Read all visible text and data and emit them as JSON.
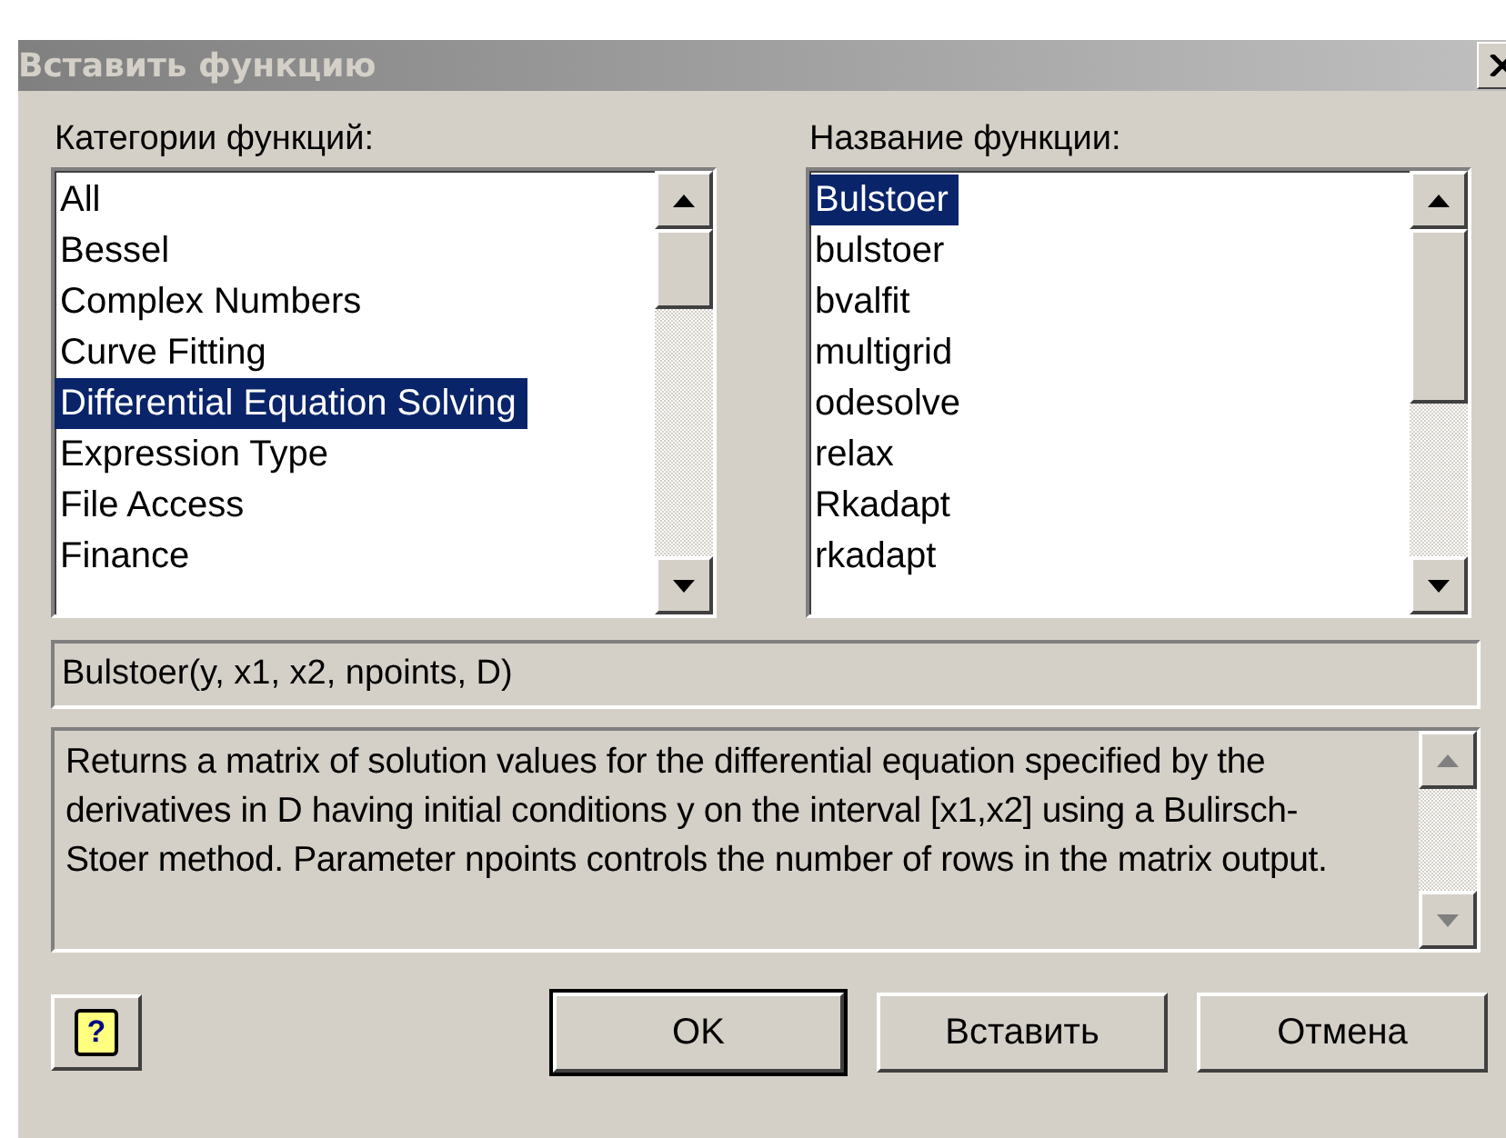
{
  "window": {
    "title": "Вставить функцию"
  },
  "categories": {
    "label": "Категории функций:",
    "items": [
      {
        "label": "All",
        "selected": false
      },
      {
        "label": "Bessel",
        "selected": false
      },
      {
        "label": "Complex Numbers",
        "selected": false
      },
      {
        "label": "Curve Fitting",
        "selected": false
      },
      {
        "label": "Differential Equation Solving",
        "selected": true
      },
      {
        "label": "Expression Type",
        "selected": false
      },
      {
        "label": "File Access",
        "selected": false
      },
      {
        "label": "Finance",
        "selected": false
      }
    ]
  },
  "functions": {
    "label": "Название функции:",
    "items": [
      {
        "label": "Bulstoer",
        "selected": true
      },
      {
        "label": "bulstoer",
        "selected": false
      },
      {
        "label": "bvalfit",
        "selected": false
      },
      {
        "label": "multigrid",
        "selected": false
      },
      {
        "label": "odesolve",
        "selected": false
      },
      {
        "label": "relax",
        "selected": false
      },
      {
        "label": "Rkadapt",
        "selected": false
      },
      {
        "label": "rkadapt",
        "selected": false
      }
    ]
  },
  "signature": "Bulstoer(y, x1, x2, npoints, D)",
  "description": "Returns a matrix of solution values for the differential equation specified by the derivatives in D having initial conditions y on the interval [x1,x2] using a Bulirsch-Stoer method. Parameter npoints controls the number of rows in the matrix output.",
  "help_button": "?",
  "buttons": [
    {
      "label": "OK",
      "default": true
    },
    {
      "label": "Вставить",
      "default": false
    },
    {
      "label": "Отмена",
      "default": false
    }
  ]
}
